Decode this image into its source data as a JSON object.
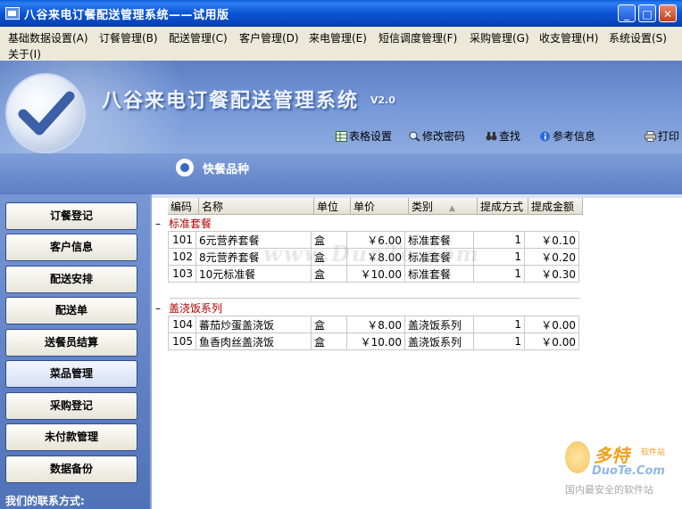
{
  "window": {
    "title": "八谷来电订餐配送管理系统——试用版",
    "controls": {
      "minimize": "_",
      "maximize": "□",
      "close": "✕"
    }
  },
  "menu": [
    "基础数据设置(A)",
    "订餐管理(B)",
    "配送管理(C)",
    "客户管理(D)",
    "来电管理(E)",
    "短信调度管理(F)",
    "采购管理(G)",
    "收支管理(H)",
    "系统设置(S)",
    "关于(I)"
  ],
  "banner": {
    "title": "八谷来电订餐配送管理系统",
    "version": "V2.0"
  },
  "toolbar": [
    {
      "label": "表格设置",
      "icon": "table-settings-icon"
    },
    {
      "label": "修改密码",
      "icon": "magnifier-key-icon"
    },
    {
      "label": "查找",
      "icon": "binoculars-icon"
    },
    {
      "label": "参考信息",
      "icon": "info-icon"
    },
    {
      "label": "打印",
      "icon": "printer-icon"
    }
  ],
  "section": {
    "title": "快餐品种"
  },
  "sidebar": {
    "items": [
      "订餐登记",
      "客户信息",
      "配送安排",
      "配送单",
      "送餐员结算",
      "菜品管理",
      "采购登记",
      "未付款管理",
      "数据备份"
    ],
    "active_index": 5,
    "contact_label": "我们的联系方式:"
  },
  "grid": {
    "columns": [
      "编码",
      "名称",
      "单位",
      "单价",
      "类别",
      "提成方式",
      "提成金额"
    ],
    "sorted_column": "类别",
    "groups": [
      {
        "name": "标准套餐",
        "rows": [
          {
            "code": "101",
            "name": "6元营养套餐",
            "unit": "盒",
            "price": "￥6.00",
            "category": "标准套餐",
            "method": "1",
            "amount": "￥0.10"
          },
          {
            "code": "102",
            "name": "8元营养套餐",
            "unit": "盒",
            "price": "￥8.00",
            "category": "标准套餐",
            "method": "1",
            "amount": "￥0.20"
          },
          {
            "code": "103",
            "name": "10元标准餐",
            "unit": "盒",
            "price": "￥10.00",
            "category": "标准套餐",
            "method": "1",
            "amount": "￥0.30"
          }
        ]
      },
      {
        "name": "盖浇饭系列",
        "rows": [
          {
            "code": "104",
            "name": "蕃茄炒蛋盖浇饭",
            "unit": "盒",
            "price": "￥8.00",
            "category": "盖浇饭系列",
            "method": "1",
            "amount": "￥0.00"
          },
          {
            "code": "105",
            "name": "鱼香肉丝盖浇饭",
            "unit": "盒",
            "price": "￥10.00",
            "category": "盖浇饭系列",
            "method": "1",
            "amount": "￥0.00"
          }
        ]
      }
    ]
  },
  "watermark": {
    "center": "www.DuoTe.com",
    "brand": "多特",
    "brand_sub": "软件站",
    "domain": "DuoTe.Com",
    "tagline": "国内最安全的软件站"
  }
}
